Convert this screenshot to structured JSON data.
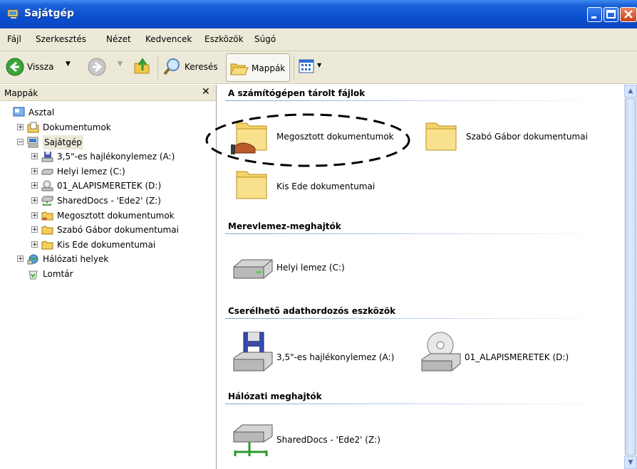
{
  "window": {
    "title": "Sajátgép"
  },
  "menu": [
    {
      "label": "Fájl"
    },
    {
      "label": "Szerkesztés"
    },
    {
      "label": "Nézet"
    },
    {
      "label": "Kedvencek"
    },
    {
      "label": "Eszközök"
    },
    {
      "label": "Súgó"
    }
  ],
  "toolbar": {
    "back_label": "Vissza",
    "search_label": "Keresés",
    "folders_label": "Mappák"
  },
  "left_pane": {
    "title": "Mappák",
    "tree": [
      {
        "label": "Asztal",
        "icon": "desktop-icon"
      },
      {
        "label": "Dokumentumok",
        "icon": "documents-icon"
      },
      {
        "label": "Sajátgép",
        "icon": "computer-icon",
        "selected": true
      },
      {
        "label": "3,5\"-es hajlékonylemez (A:)",
        "icon": "floppy-icon"
      },
      {
        "label": "Helyi lemez (C:)",
        "icon": "harddisk-icon"
      },
      {
        "label": "01_ALAPISMERETEK (D:)",
        "icon": "cd-icon"
      },
      {
        "label": "SharedDocs - 'Ede2' (Z:)",
        "icon": "network-drive-icon"
      },
      {
        "label": "Megosztott dokumentumok",
        "icon": "shared-folder-icon"
      },
      {
        "label": "Szabó Gábor dokumentumai",
        "icon": "folder-icon"
      },
      {
        "label": "Kis Ede dokumentumai",
        "icon": "folder-icon"
      },
      {
        "label": "Hálózati helyek",
        "icon": "network-places-icon"
      },
      {
        "label": "Lomtár",
        "icon": "recycle-bin-icon"
      }
    ]
  },
  "groups": [
    {
      "title": "A számítógépen tárolt fájlok",
      "items": [
        {
          "label": "Megosztott dokumentumok",
          "icon": "shared-folder-icon",
          "highlighted": true
        },
        {
          "label": "Szabó Gábor dokumentumai",
          "icon": "folder-icon"
        },
        {
          "label": "Kis Ede dokumentumai",
          "icon": "folder-icon"
        }
      ]
    },
    {
      "title": "Merevlemez-meghajtók",
      "items": [
        {
          "label": "Helyi lemez (C:)",
          "icon": "harddisk-icon"
        }
      ]
    },
    {
      "title": "Cserélhető adathordozós eszközök",
      "items": [
        {
          "label": "3,5\"-es hajlékonylemez (A:)",
          "icon": "floppy-icon"
        },
        {
          "label": "01_ALAPISMERETEK (D:)",
          "icon": "cd-icon"
        }
      ]
    },
    {
      "title": "Hálózati meghajtók",
      "items": [
        {
          "label": "SharedDocs - 'Ede2' (Z:)",
          "icon": "network-drive-icon"
        }
      ]
    }
  ]
}
